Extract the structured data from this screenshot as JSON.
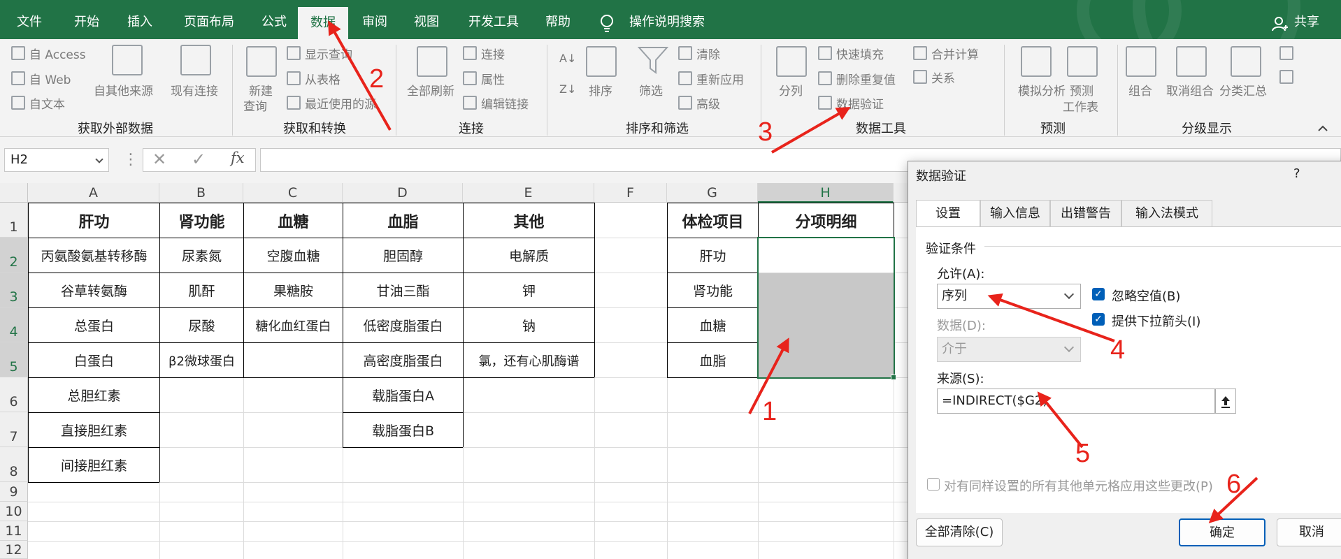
{
  "menu": {
    "items": [
      "文件",
      "开始",
      "插入",
      "页面布局",
      "公式",
      "数据",
      "审阅",
      "视图",
      "开发工具",
      "帮助"
    ],
    "search_label": "操作说明搜索",
    "share_label": "共享"
  },
  "ribbon": {
    "get_external": {
      "access": "自 Access",
      "web": "自 Web",
      "text": "自文本",
      "other": "自其他来源",
      "existing": "现有连接",
      "group": "获取外部数据"
    },
    "transform": {
      "new_query": "新建",
      "new_query2": "查询",
      "show_query": "显示查询",
      "from_table": "从表格",
      "recent": "最近使用的源",
      "group": "获取和转换"
    },
    "connections": {
      "refresh_all": "全部刷新",
      "connect": "连接",
      "props": "属性",
      "edit_links": "编辑链接",
      "group": "连接"
    },
    "sort": {
      "sort": "排序",
      "filter": "筛选",
      "clear": "清除",
      "reapply": "重新应用",
      "advanced": "高级",
      "group": "排序和筛选"
    },
    "tools": {
      "split": "分列",
      "flash_fill": "快速填充",
      "remove_dup": "删除重复值",
      "data_validation": "数据验证",
      "consolidate": "合并计算",
      "relations": "关系",
      "group": "数据工具"
    },
    "forecast": {
      "whatif": "模拟分析",
      "sheet": "预测",
      "sheet2": "工作表",
      "group": "预测"
    },
    "outline": {
      "group_btn": "组合",
      "ungroup": "取消组合",
      "subtotal": "分类汇总",
      "group": "分级显示"
    }
  },
  "formula_bar": {
    "name_box": "H2",
    "fx": "fx",
    "content": ""
  },
  "sheet": {
    "columns": [
      "A",
      "B",
      "C",
      "D",
      "E",
      "F",
      "G",
      "H"
    ],
    "rows": [
      "1",
      "2",
      "3",
      "4",
      "5",
      "6",
      "7",
      "8",
      "9",
      "10",
      "11",
      "12"
    ],
    "headers": {
      "A": "肝功",
      "B": "肾功能",
      "C": "血糖",
      "D": "血脂",
      "E": "其他",
      "G": "体检项目",
      "H": "分项明细"
    },
    "colA": [
      "丙氨酸氨基转移酶",
      "谷草转氨酶",
      "总蛋白",
      "白蛋白",
      "总胆红素",
      "直接胆红素",
      "间接胆红素"
    ],
    "colB": [
      "尿素氮",
      "肌酐",
      "尿酸",
      "β2微球蛋白"
    ],
    "colC": [
      "空腹血糖",
      "果糖胺",
      "糖化血红蛋白"
    ],
    "colD": [
      "胆固醇",
      "甘油三酯",
      "低密度脂蛋白",
      "高密度脂蛋白",
      "载脂蛋白A",
      "载脂蛋白B"
    ],
    "colE": [
      "电解质",
      "钾",
      "钠",
      "氯，还有心肌酶谱"
    ],
    "colG": [
      "肝功",
      "肾功能",
      "血糖",
      "血脂"
    ]
  },
  "dialog": {
    "title": "数据验证",
    "help": "?",
    "tabs": [
      "设置",
      "输入信息",
      "出错警告",
      "输入法模式"
    ],
    "criteria": "验证条件",
    "allow_label": "允许(A):",
    "allow_value": "序列",
    "data_label": "数据(D):",
    "data_value": "介于",
    "ignore_blank": "忽略空值(B)",
    "dropdown": "提供下拉箭头(I)",
    "source_label": "来源(S):",
    "source_value": "=INDIRECT($G2)",
    "apply_all": "对有同样设置的所有其他单元格应用这些更改(P)",
    "clear_all": "全部清除(C)",
    "ok": "确定",
    "cancel": "取消"
  },
  "annotations": [
    "1",
    "2",
    "3",
    "4",
    "5",
    "6"
  ],
  "colors": {
    "excel_green": "#217346",
    "annotation_red": "#e8231b",
    "selection_gray": "#c8c8c8",
    "checkbox_blue": "#005fb8"
  }
}
